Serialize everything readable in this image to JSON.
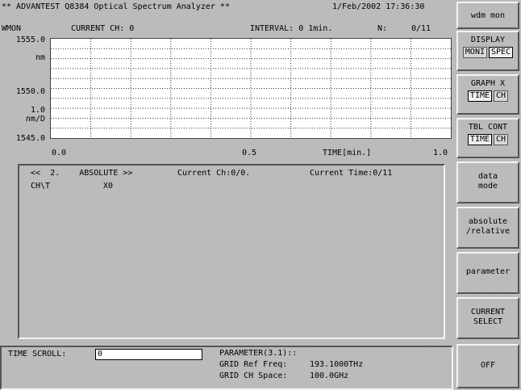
{
  "title_bar": {
    "instrument": "** ADVANTEST Q8384 Optical Spectrum Analyzer **",
    "datetime": "1/Feb/2002 17:36:30",
    "mode": "wdm mon"
  },
  "graph_header": {
    "label": "WMON",
    "current_ch": "CURRENT CH: 0",
    "interval": "INTERVAL: 0 1min.",
    "n_label": "N:",
    "n_value": "0/11"
  },
  "y_axis": {
    "top": "1555.0",
    "top_unit": "nm",
    "mid": "1550.0",
    "scale": "1.0",
    "scale_unit": "nm/D",
    "bottom": "1545.0"
  },
  "x_axis": {
    "start": "0.0",
    "mid": "0.5",
    "label": "TIME[min.]",
    "end": "1.0"
  },
  "table": {
    "header_left": "<<  2.    ABSOLUTE >>",
    "header_mid": "Current Ch:0/0.",
    "header_right": "Current Time:0/11",
    "col1": "CH\\T",
    "col2": "X0"
  },
  "softkeys": {
    "display": {
      "label": "DISPLAY",
      "opt1": "MONI",
      "opt2": "SPEC",
      "selected": "SPEC"
    },
    "graph_x": {
      "label": "GRAPH X",
      "opt1": "TIME",
      "opt2": "CH",
      "selected": "TIME"
    },
    "tbl_cont": {
      "label": "TBL CONT",
      "opt1": "TIME",
      "opt2": "CH",
      "selected": "TIME"
    },
    "data_mode": {
      "line1": "data",
      "line2": "mode"
    },
    "abs_rel": {
      "line1": "absolute",
      "line2": "/relative"
    },
    "parameter": "parameter",
    "current_select": {
      "line1": "CURRENT",
      "line2": "SELECT"
    },
    "off": "OFF"
  },
  "bottom": {
    "time_scroll_label": "TIME SCROLL:",
    "time_scroll_value": "0",
    "param_title": "PARAMETER(3.1)::",
    "grid_ref_label": "GRID Ref Freq:",
    "grid_ref_value": "193.1000THz",
    "grid_space_label": "GRID CH Space:",
    "grid_space_value": "100.0GHz"
  }
}
